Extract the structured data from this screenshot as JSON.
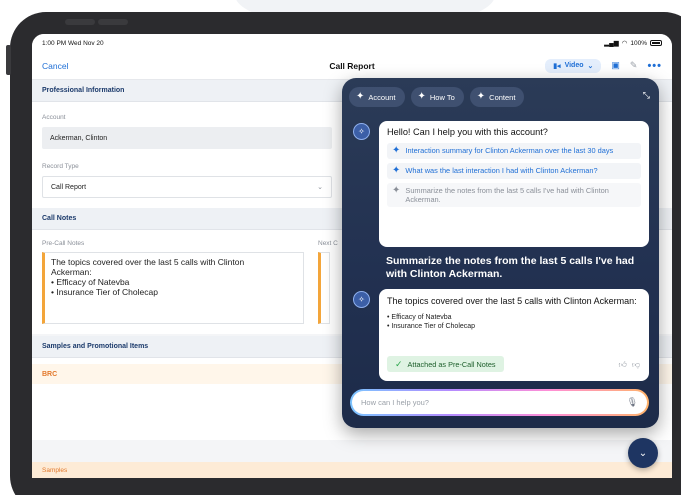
{
  "status": {
    "time": "1:00 PM  Wed Nov 20",
    "battery": "100%"
  },
  "nav": {
    "cancel": "Cancel",
    "title": "Call Report",
    "video": "Video"
  },
  "sections": {
    "professional": "Professional Information",
    "call_notes": "Call Notes",
    "samples_promo": "Samples and Promotional Items",
    "brc": "BRC",
    "samples": "Samples"
  },
  "form": {
    "account_label": "Account",
    "account_value": "Ackerman, Clinton",
    "record_type_label": "Record Type",
    "record_type_value": "Call Report"
  },
  "notes": {
    "pre_call_label": "Pre-Call Notes",
    "next_call_label": "Next C",
    "line1": "The topics covered over the last 5 calls with Clinton",
    "line2": "Ackerman:",
    "line3": "• Efficacy of Natevba",
    "line4": "• Insurance Tier of Cholecap"
  },
  "assistant": {
    "chips": [
      "Account",
      "How To",
      "Content"
    ],
    "greeting": "Hello! Can I help you with this account?",
    "suggestions": [
      "Interaction summary for Clinton Ackerman over the last 30 days",
      "What was the last interaction I had with Clinton Ackerman?",
      "Summarize the notes from the last 5 calls I've had with Clinton Ackerman."
    ],
    "user_question": "Summarize the notes from the last 5 calls I've had with Clinton Ackerman.",
    "response_title": "The topics covered over the last 5 calls with Clinton Ackerman:",
    "response_bullets": [
      "• Efficacy of Natevba",
      "• Insurance Tier of Cholecap"
    ],
    "attached": "Attached as Pre-Call Notes",
    "input_placeholder": "How can I help you?"
  }
}
